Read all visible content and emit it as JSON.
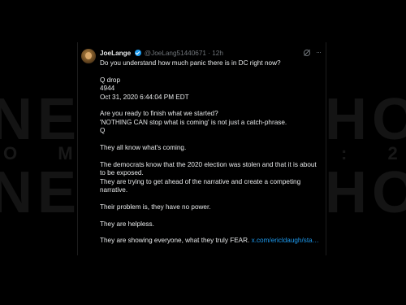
{
  "background": {
    "row1_left": "NE",
    "row1_right": "HOV",
    "row2_left": "O M",
    "row2_right": ": 2",
    "row3_left": "NE",
    "row3_right": "HOV"
  },
  "tweet": {
    "username": "JoeLange",
    "handle": "@JoeLang51440671",
    "separator": "·",
    "time": "12h",
    "lines": [
      "Do you understand how much panic there is in DC right now?",
      "",
      "Q drop",
      "4944",
      "Oct 31, 2020 6:44:04 PM EDT",
      "",
      "Are you ready to finish what we started?",
      "'NOTHING CAN stop what is coming' is not just a catch-phrase.",
      "Q",
      "",
      "They all know what's coming.",
      "",
      "The democrats know that the 2020 election was stolen and that it is about to be exposed.",
      "They are trying to get ahead of the narrative and create a competing narrative.",
      "",
      "Their problem is, they have no power.",
      "",
      "They are helpless.",
      ""
    ],
    "last_line": "They are showing everyone, what they truly FEAR.",
    "link_text": "x.com/ericldaugh/sta…"
  },
  "colors": {
    "page_bg": "#000000",
    "text": "#e7e9ea",
    "muted": "#71767b",
    "link": "#1d9bf0",
    "verified": "#1d9bf0"
  },
  "icons": {
    "verified": "verified-badge-icon",
    "grok": "grok-icon",
    "more": "more-icon"
  }
}
